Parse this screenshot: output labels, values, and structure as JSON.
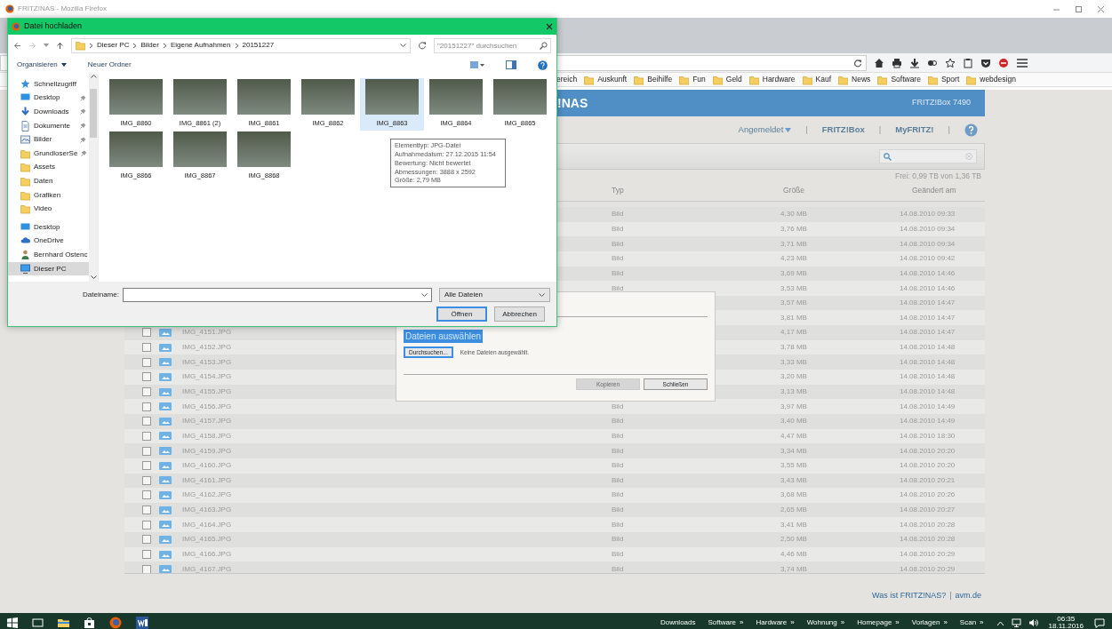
{
  "browser": {
    "title": "FRITZ!NAS - Mozilla Firefox",
    "bookmarks": [
      "ereich",
      "Auskunft",
      "Beihilfe",
      "Fun",
      "Geld",
      "Hardware",
      "Kauf",
      "News",
      "Software",
      "Sport",
      "webdesign"
    ]
  },
  "page": {
    "brand": "!NAS",
    "model": "FRITZ!Box 7490",
    "account": "Angemeldet",
    "links": [
      {
        "kind": "separator",
        "text": "|"
      },
      {
        "kind": "link",
        "text": "FRITZ!Box"
      },
      {
        "kind": "separator",
        "text": "|"
      },
      {
        "kind": "link",
        "text": "MyFRITZ!"
      },
      {
        "kind": "separator",
        "text": "|"
      }
    ],
    "storage": "Frei: 0,99 TB von 1,36 TB",
    "columns": [
      "Typ",
      "Größe",
      "Geändert am"
    ],
    "rows": [
      {
        "type": "Bild",
        "size": "4,30 MB",
        "modified": "14.08.2010 09:33"
      },
      {
        "type": "Bild",
        "size": "3,76 MB",
        "modified": "14.08.2010 09:34"
      },
      {
        "type": "Bild",
        "size": "3,71 MB",
        "modified": "14.08.2010 09:34"
      },
      {
        "type": "Bild",
        "size": "4,23 MB",
        "modified": "14.08.2010 09:42"
      },
      {
        "type": "Bild",
        "size": "3,69 MB",
        "modified": "14.08.2010 14:46"
      },
      {
        "type": "Bild",
        "size": "3,53 MB",
        "modified": "14.08.2010 14:46"
      },
      {
        "size": "3,57 MB",
        "modified": "14.08.2010 14:47"
      },
      {
        "size": "3,81 MB",
        "modified": "14.08.2010 14:47"
      },
      {
        "name": "IMG_4151.JPG",
        "checked": false,
        "size": "4,17 MB",
        "modified": "14.08.2010 14:47"
      },
      {
        "name": "IMG_4152.JPG",
        "checked": false,
        "size": "3,78 MB",
        "modified": "14.08.2010 14:48"
      },
      {
        "name": "IMG_4153.JPG",
        "checked": false,
        "size": "3,33 MB",
        "modified": "14.08.2010 14:48"
      },
      {
        "name": "IMG_4154.JPG",
        "checked": false,
        "size": "3,20 MB",
        "modified": "14.08.2010 14:48"
      },
      {
        "name": "IMG_4155.JPG",
        "checked": false,
        "size": "3,13 MB",
        "modified": "14.08.2010 14:48"
      },
      {
        "name": "IMG_4156.JPG",
        "checked": false,
        "type": "Bild",
        "size": "3,97 MB",
        "modified": "14.08.2010 14:49"
      },
      {
        "name": "IMG_4157.JPG",
        "checked": false,
        "type": "Bild",
        "size": "3,40 MB",
        "modified": "14.08.2010 14:49"
      },
      {
        "name": "IMG_4158.JPG",
        "checked": false,
        "type": "Bild",
        "size": "4,47 MB",
        "modified": "14.08.2010 18:30"
      },
      {
        "name": "IMG_4159.JPG",
        "checked": false,
        "type": "Bild",
        "size": "3,34 MB",
        "modified": "14.08.2010 20:20"
      },
      {
        "name": "IMG_4160.JPG",
        "checked": false,
        "type": "Bild",
        "size": "3,55 MB",
        "modified": "14.08.2010 20:20"
      },
      {
        "name": "IMG_4161.JPG",
        "checked": false,
        "type": "Bild",
        "size": "3,43 MB",
        "modified": "14.08.2010 20:21"
      },
      {
        "name": "IMG_4162.JPG",
        "checked": false,
        "type": "Bild",
        "size": "3,68 MB",
        "modified": "14.08.2010 20:26"
      },
      {
        "name": "IMG_4163.JPG",
        "checked": false,
        "type": "Bild",
        "size": "2,65 MB",
        "modified": "14.08.2010 20:27"
      },
      {
        "name": "IMG_4164.JPG",
        "checked": false,
        "type": "Bild",
        "size": "3,41 MB",
        "modified": "14.08.2010 20:28"
      },
      {
        "name": "IMG_4165.JPG",
        "checked": false,
        "type": "Bild",
        "size": "2,50 MB",
        "modified": "14.08.2010 20:28"
      },
      {
        "name": "IMG_4166.JPG",
        "checked": false,
        "type": "Bild",
        "size": "4,46 MB",
        "modified": "14.08.2010 20:29"
      },
      {
        "name": "IMG_4167.JPG",
        "checked": false,
        "type": "Bild",
        "size": "3,74 MB",
        "modified": "14.08.2010 20:29"
      }
    ],
    "footer": [
      {
        "kind": "link",
        "text": "Was ist FRITZ!NAS?"
      },
      {
        "kind": "separator",
        "text": "|"
      },
      {
        "kind": "link",
        "text": "avm.de"
      }
    ]
  },
  "upload_dialog": {
    "heading": "Dateien auswählen",
    "browse_button": "Durchsuchen...",
    "file_status": "Keine Dateien ausgewählt.",
    "buttons": [
      {
        "label": "Kopieren",
        "disabled": true
      },
      {
        "label": "Schließen",
        "disabled": false
      }
    ]
  },
  "file_dialog": {
    "title": "Datei hochladen",
    "path": [
      "Dieser PC",
      "Bilder",
      "Eigene Aufnahmen",
      "20151227"
    ],
    "search": {
      "placeholder": "\"20151227\" durchsuchen"
    },
    "toolbar": [
      "Organisieren",
      "Neuer Ordner"
    ],
    "nav": [
      {
        "label": "Schnellzugriff",
        "kind": "star",
        "pinned": false,
        "selected": false
      },
      {
        "label": "Desktop",
        "kind": "desktop",
        "pinned": true,
        "selected": false
      },
      {
        "label": "Downloads",
        "kind": "download",
        "pinned": true,
        "selected": false
      },
      {
        "label": "Dokumente",
        "kind": "document",
        "pinned": true,
        "selected": false
      },
      {
        "label": "Bilder",
        "kind": "pictures",
        "pinned": true,
        "selected": false
      },
      {
        "label": "GrundloserSe",
        "kind": "folder",
        "pinned": true,
        "selected": false
      },
      {
        "label": "Assets",
        "kind": "folder",
        "pinned": false,
        "selected": false
      },
      {
        "label": "Daten",
        "kind": "folder",
        "pinned": false,
        "selected": false
      },
      {
        "label": "Grafiken",
        "kind": "folder",
        "pinned": false,
        "selected": false
      },
      {
        "label": "Video",
        "kind": "folder",
        "pinned": false,
        "selected": false
      },
      {
        "label": "Desktop",
        "kind": "desktop",
        "pinned": false,
        "selected": false
      },
      {
        "label": "OneDrive",
        "kind": "cloud",
        "pinned": false,
        "selected": false
      },
      {
        "label": "Bernhard Ostenc",
        "kind": "user",
        "pinned": false,
        "selected": false
      },
      {
        "label": "Dieser PC",
        "kind": "pc",
        "pinned": false,
        "selected": true
      }
    ],
    "files": [
      {
        "name": "IMG_8860",
        "selected": false
      },
      {
        "name": "IMG_8861 (2)",
        "selected": false
      },
      {
        "name": "IMG_8861",
        "selected": false
      },
      {
        "name": "IMG_8862",
        "selected": false
      },
      {
        "name": "IMG_8863",
        "selected": true
      },
      {
        "name": "IMG_8864",
        "selected": false
      },
      {
        "name": "IMG_8865",
        "selected": false
      },
      {
        "name": "IMG_8866",
        "selected": false
      },
      {
        "name": "IMG_8867",
        "selected": false
      },
      {
        "name": "IMG_8868",
        "selected": false
      }
    ],
    "tooltip": [
      "Elementtyp: JPG-Datei",
      "Aufnahmedatum: 27.12.2015 11:54",
      "Bewertung: Nicht bewertet",
      "Abmessungen: 3888 x 2592",
      "Größe: 2,79 MB"
    ],
    "filename_label": "Dateiname:",
    "file_type": "Alle Dateien",
    "buttons": [
      "Öffnen",
      "Abbrechen"
    ]
  },
  "taskbar": {
    "toolbars": [
      {
        "label": "Downloads"
      },
      {
        "label": "Software",
        "chevron": "»"
      },
      {
        "label": "Hardware",
        "chevron": "»"
      },
      {
        "label": "Wohnung",
        "chevron": "»"
      },
      {
        "label": "Homepage",
        "chevron": "»"
      },
      {
        "label": "Vorlagen",
        "chevron": "»"
      },
      {
        "label": "Scan",
        "chevron": "»"
      }
    ],
    "time": "06:35",
    "date": "18.11.2016"
  }
}
